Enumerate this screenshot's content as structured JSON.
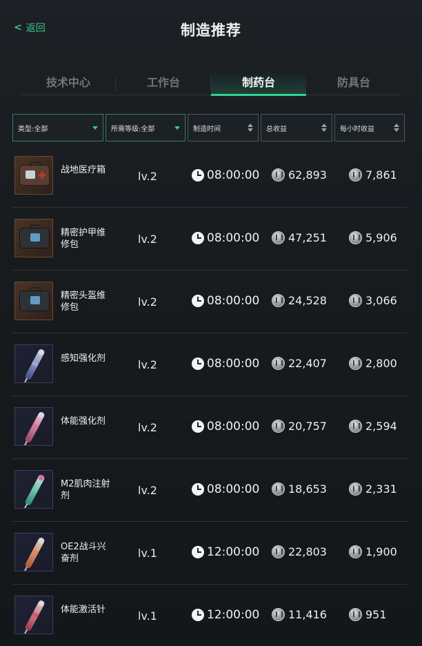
{
  "header": {
    "back_label": "返回",
    "title": "制造推荐"
  },
  "tabs": [
    {
      "label": "技术中心",
      "active": false
    },
    {
      "label": "工作台",
      "active": false
    },
    {
      "label": "制药台",
      "active": true
    },
    {
      "label": "防具台",
      "active": false
    }
  ],
  "filters": {
    "type": "类型:全部",
    "level": "所需等级:全部",
    "craft_time": "制造时间",
    "total_income": "总收益",
    "hourly_income": "每小时收益"
  },
  "colors": {
    "accent": "#2fd394",
    "back_text": "#34c98a",
    "background": "#171b1e"
  },
  "icons": {
    "back": "chevron-left-icon",
    "clock": "clock-icon",
    "coin": "coin-icon",
    "dropdown": "caret-down-icon",
    "sort": "sort-icon"
  },
  "items": [
    {
      "name": "战地医疗箱",
      "level": "lv.2",
      "time": "08:00:00",
      "total": "62,893",
      "hourly": "7,861",
      "icon": "medkit-icon",
      "style": "medkit"
    },
    {
      "name": "精密护甲维修包",
      "level": "lv.2",
      "time": "08:00:00",
      "total": "47,251",
      "hourly": "5,906",
      "icon": "armor-repair-kit-icon",
      "style": "repair"
    },
    {
      "name": "精密头盔维修包",
      "level": "lv.2",
      "time": "08:00:00",
      "total": "24,528",
      "hourly": "3,066",
      "icon": "helmet-repair-kit-icon",
      "style": "repair"
    },
    {
      "name": "感知强化剂",
      "level": "lv.2",
      "time": "08:00:00",
      "total": "22,407",
      "hourly": "2,800",
      "icon": "injector-icon",
      "style": "inj-blue"
    },
    {
      "name": "体能强化剂",
      "level": "lv.2",
      "time": "08:00:00",
      "total": "20,757",
      "hourly": "2,594",
      "icon": "injector-icon",
      "style": "inj-pink"
    },
    {
      "name": "M2肌肉注射剂",
      "level": "lv.2",
      "time": "08:00:00",
      "total": "18,653",
      "hourly": "2,331",
      "icon": "injector-icon",
      "style": "inj-teal"
    },
    {
      "name": "OE2战斗兴奋剂",
      "level": "lv.1",
      "time": "12:00:00",
      "total": "22,803",
      "hourly": "1,900",
      "icon": "injector-icon",
      "style": "inj-orange"
    },
    {
      "name": "体能激活针",
      "level": "lv.1",
      "time": "12:00:00",
      "total": "11,416",
      "hourly": "951",
      "icon": "injector-icon",
      "style": "inj-red"
    }
  ]
}
